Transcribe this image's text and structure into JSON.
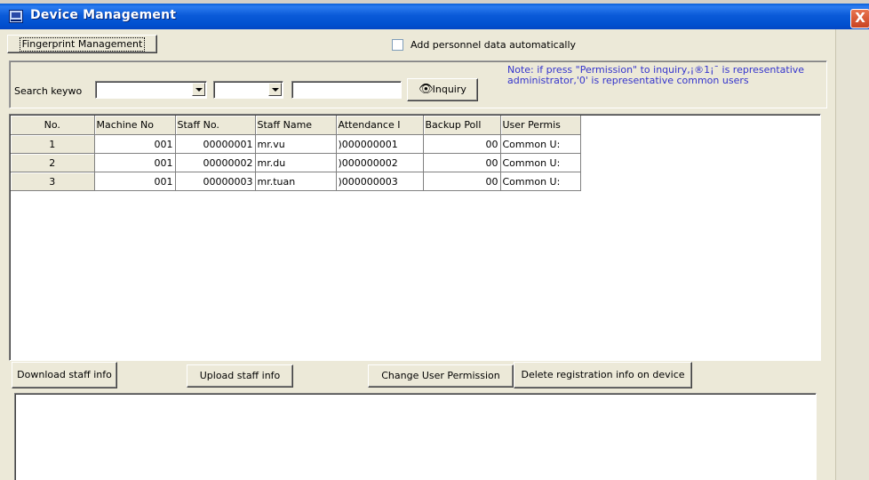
{
  "window": {
    "title": "Device Management",
    "close_label": "X"
  },
  "tab": {
    "label": "Fingerprint Management"
  },
  "options": {
    "auto_add_label": "Add personnel data automatically",
    "auto_add_checked": false
  },
  "search": {
    "label": "Search keywo",
    "combo1_value": "",
    "combo2_value": "",
    "text_value": "",
    "inquiry_label": "Inquiry"
  },
  "note": "Note: if press \"Permission\" to inquiry,¡®1¡¯ is representative administrator,'0' is representative common users",
  "table": {
    "columns": [
      "No.",
      "Machine No",
      "Staff No.",
      "Staff Name",
      "Attendance I",
      "Backup Poll",
      "User Permis"
    ],
    "rows": [
      [
        "1",
        "001",
        "00000001",
        "mr.vu",
        ")000000001",
        "00",
        "Common U:"
      ],
      [
        "2",
        "001",
        "00000002",
        "mr.du",
        ")000000002",
        "00",
        "Common U:"
      ],
      [
        "3",
        "001",
        "00000003",
        "mr.tuan",
        ")000000003",
        "00",
        "Common U:"
      ]
    ]
  },
  "buttons": {
    "download": "Download staff info",
    "upload": "Upload staff info",
    "change_permission": "Change User Permission",
    "delete": "Delete registration info on device"
  },
  "log": {
    "text": ""
  }
}
